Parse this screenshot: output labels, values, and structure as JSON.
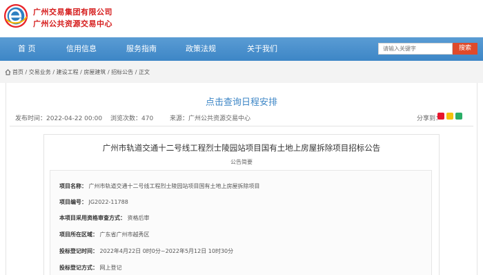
{
  "header": {
    "org_name_1": "广州交易集团有限公司",
    "org_name_2": "广州公共资源交易中心",
    "brand_color": "#d51c1c"
  },
  "nav": {
    "items": [
      {
        "label": "首 页"
      },
      {
        "label": "信用信息"
      },
      {
        "label": "服务指南"
      },
      {
        "label": "政策法规"
      },
      {
        "label": "关于我们"
      }
    ],
    "bar_color": "#4a91cd"
  },
  "search": {
    "placeholder": "请输入关键字",
    "button_label": "搜索"
  },
  "breadcrumb": {
    "items": [
      "首页",
      "交易业务",
      "建设工程",
      "房屋建筑",
      "招标公告",
      "正文"
    ],
    "separator": "/"
  },
  "schedule_link": "点击查询日程安排",
  "meta": {
    "publish_label": "发布时间：",
    "publish_time": "2022-04-22 00:00",
    "views_label": "浏览次数：",
    "views": "470",
    "source_label": "来源：",
    "source": "广州公共资源交易中心",
    "share_label": "分享到："
  },
  "document": {
    "title": "广州市轨道交通十二号线工程烈士陵园站项目国有土地上房屋拆除项目招标公告",
    "subtitle": "公告简要",
    "fields": [
      {
        "key": "项目名称：",
        "value": "广州市轨道交通十二号线工程烈士陵园站项目国有土地上房屋拆除项目"
      },
      {
        "key": "项目编号：",
        "value": "JG2022-11788"
      },
      {
        "key": "本项目采用资格审查方式：",
        "value": "资格后审"
      },
      {
        "key": "项目所在区域：",
        "value": "广东省广州市越秀区"
      },
      {
        "key": "投标登记时间：",
        "value": "2022年4月22日 0时0分~2022年5月12日 10时30分"
      },
      {
        "key": "投标登记方式：",
        "value": "网上登记"
      }
    ]
  },
  "colors": {
    "nav_blue": "#4a91cd",
    "link_blue": "#3d86c6",
    "search_orange": "#e04a2a"
  }
}
